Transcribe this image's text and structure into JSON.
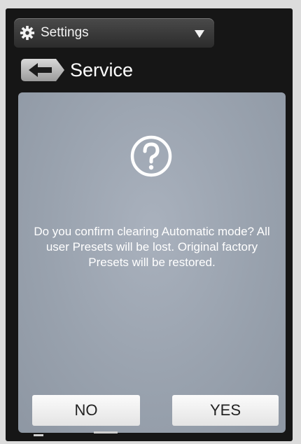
{
  "header": {
    "menu_label": "Settings",
    "menu_icon": "gear-icon",
    "dropdown_icon": "caret-down-icon"
  },
  "page": {
    "title": "Service",
    "back_icon": "back-arrow-icon"
  },
  "dialog": {
    "icon": "question-icon",
    "message": "Do you confirm clearing Automatic mode? All user Presets will be lost. Original factory Presets will be restored.",
    "no_label": "NO",
    "yes_label": "YES"
  },
  "colors": {
    "dialog_bg": "#99a2ae",
    "screen_bg": "#161616",
    "button_bg": "#f0f0f0",
    "text_light": "#ffffff"
  }
}
